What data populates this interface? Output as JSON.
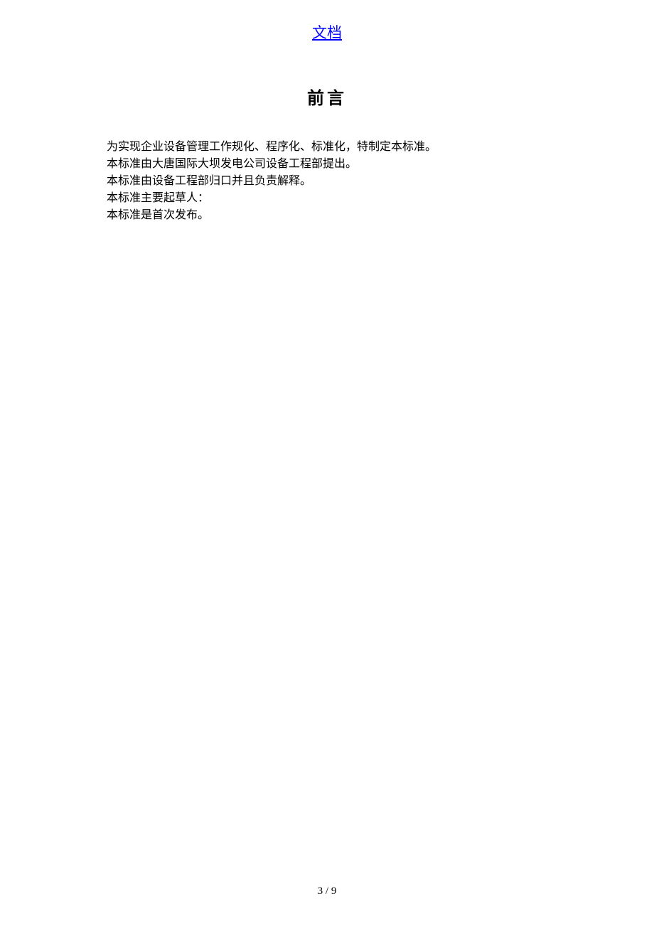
{
  "header": {
    "link_text": "文档"
  },
  "title": "前言",
  "body": {
    "paragraphs": [
      "为实现企业设备管理工作规化、程序化、标准化，特制定本标准。",
      "本标准由大唐国际大坝发电公司设备工程部提出。",
      "本标准由设备工程部归口并且负责解释。",
      "本标准主要起草人：",
      "本标准是首次发布。"
    ]
  },
  "footer": {
    "page_number": "3 / 9"
  }
}
